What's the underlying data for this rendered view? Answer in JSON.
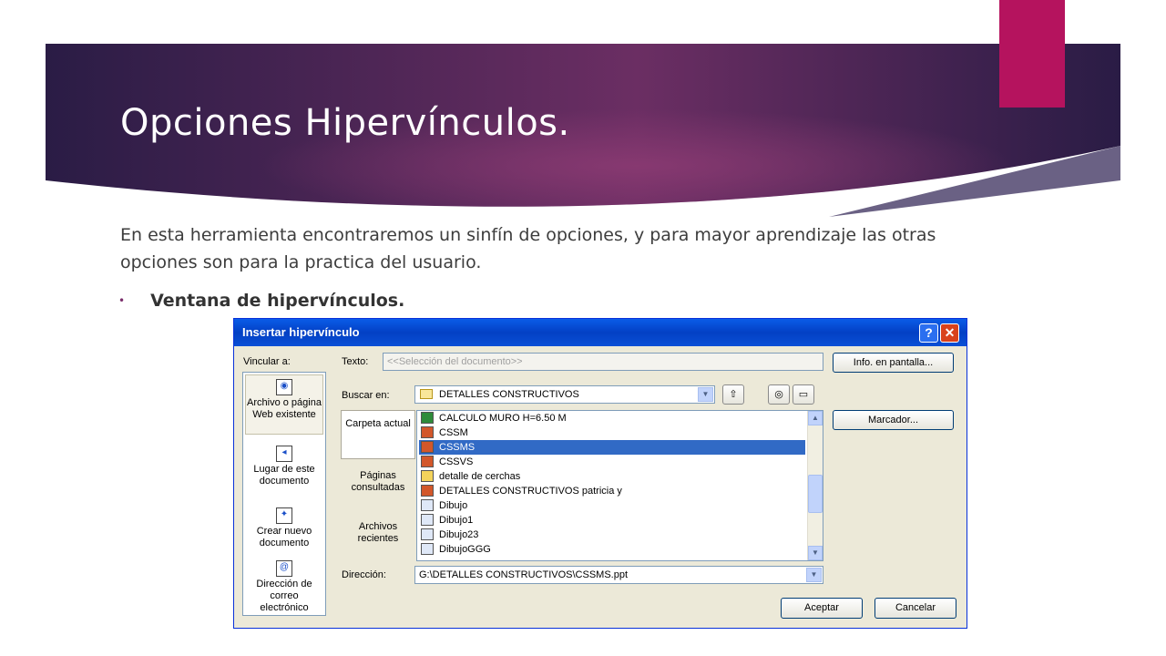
{
  "slide": {
    "title": "Opciones Hipervínculos.",
    "body": "En esta herramienta encontraremos un sinfín de opciones, y para mayor aprendizaje las otras opciones son  para la practica del usuario.",
    "bullet": "Ventana de hipervínculos."
  },
  "colors": {
    "banner_dark": "#2a1c45",
    "banner_mid": "#6b2e63",
    "accent_pink": "#b5135e"
  },
  "dialog": {
    "title": "Insertar hipervínculo",
    "help_glyph": "?",
    "close_glyph": "✕",
    "link_to_label": "Vincular a:",
    "text_label": "Texto:",
    "text_value": "<<Selección del documento>>",
    "screentip_button": "Info. en pantalla...",
    "lookin_label": "Buscar en:",
    "lookin_value": "DETALLES CONSTRUCTIVOS",
    "bookmark_button": "Marcador...",
    "address_label": "Dirección:",
    "address_value": "G:\\DETALLES CONSTRUCTIVOS\\CSSMS.ppt",
    "ok_button": "Aceptar",
    "cancel_button": "Cancelar",
    "link_targets": [
      {
        "label": "Archivo o página Web existente",
        "icon": "web-page-icon"
      },
      {
        "label": "Lugar de este documento",
        "icon": "document-place-icon"
      },
      {
        "label": "Crear nuevo documento",
        "icon": "new-document-icon"
      },
      {
        "label": "Dirección de correo electrónico",
        "icon": "email-icon"
      }
    ],
    "subfolders": [
      {
        "label": "Carpeta actual"
      },
      {
        "label": "Páginas consultadas"
      },
      {
        "label": "Archivos recientes"
      }
    ],
    "files": [
      {
        "name": "CALCULO MURO H=6.50 M",
        "icon": "excel-icon"
      },
      {
        "name": "CSSM",
        "icon": "powerpoint-icon"
      },
      {
        "name": "CSSMS",
        "icon": "powerpoint-icon"
      },
      {
        "name": "CSSVS",
        "icon": "powerpoint-icon"
      },
      {
        "name": "detalle de cerchas",
        "icon": "folder-icon"
      },
      {
        "name": "DETALLES CONSTRUCTIVOS  patricia  y",
        "icon": "powerpoint-icon"
      },
      {
        "name": "Dibujo",
        "icon": "shortcut-icon"
      },
      {
        "name": "Dibujo1",
        "icon": "shortcut-icon"
      },
      {
        "name": "Dibujo23",
        "icon": "shortcut-icon"
      },
      {
        "name": "DibujoGGG",
        "icon": "shortcut-icon"
      }
    ],
    "selected_file": "CSSMS"
  }
}
